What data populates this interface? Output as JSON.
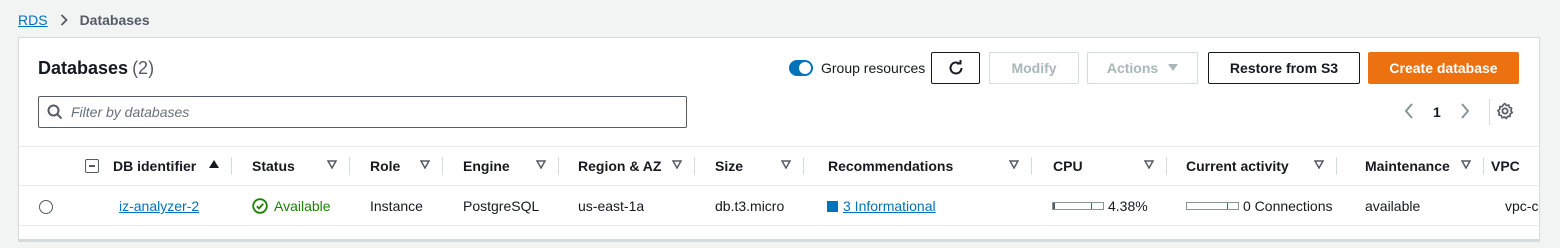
{
  "breadcrumb": {
    "root": "RDS",
    "current": "Databases"
  },
  "header": {
    "title": "Databases",
    "count": "(2)"
  },
  "toolbar": {
    "group_resources_label": "Group resources",
    "group_resources_on": true,
    "modify_label": "Modify",
    "actions_label": "Actions",
    "restore_label": "Restore from S3",
    "create_label": "Create database"
  },
  "filter": {
    "placeholder": "Filter by databases",
    "value": ""
  },
  "pagination": {
    "current_page": "1"
  },
  "columns": [
    "DB identifier",
    "Status",
    "Role",
    "Engine",
    "Region & AZ",
    "Size",
    "Recommendations",
    "CPU",
    "Current activity",
    "Maintenance",
    "VPC"
  ],
  "rows": [
    {
      "db_identifier": "iz-analyzer-2",
      "status": "Available",
      "role": "Instance",
      "engine": "PostgreSQL",
      "region_az": "us-east-1a",
      "size": "db.t3.micro",
      "recommendations": "3 Informational",
      "cpu": "4.38%",
      "cpu_percent": 4.38,
      "current_activity": "0 Connections",
      "maintenance": "available",
      "vpc": "vpc-c"
    }
  ],
  "colors": {
    "accent": "#0073bb",
    "primary": "#ec7211",
    "success": "#1d8102"
  },
  "icons": [
    "chevron-right-icon",
    "refresh-icon",
    "caret-down-icon",
    "search-icon",
    "chevron-left-icon",
    "gear-icon",
    "sort-ascending-icon",
    "sort-caret-icon",
    "check-circle-icon",
    "info-square-icon"
  ]
}
